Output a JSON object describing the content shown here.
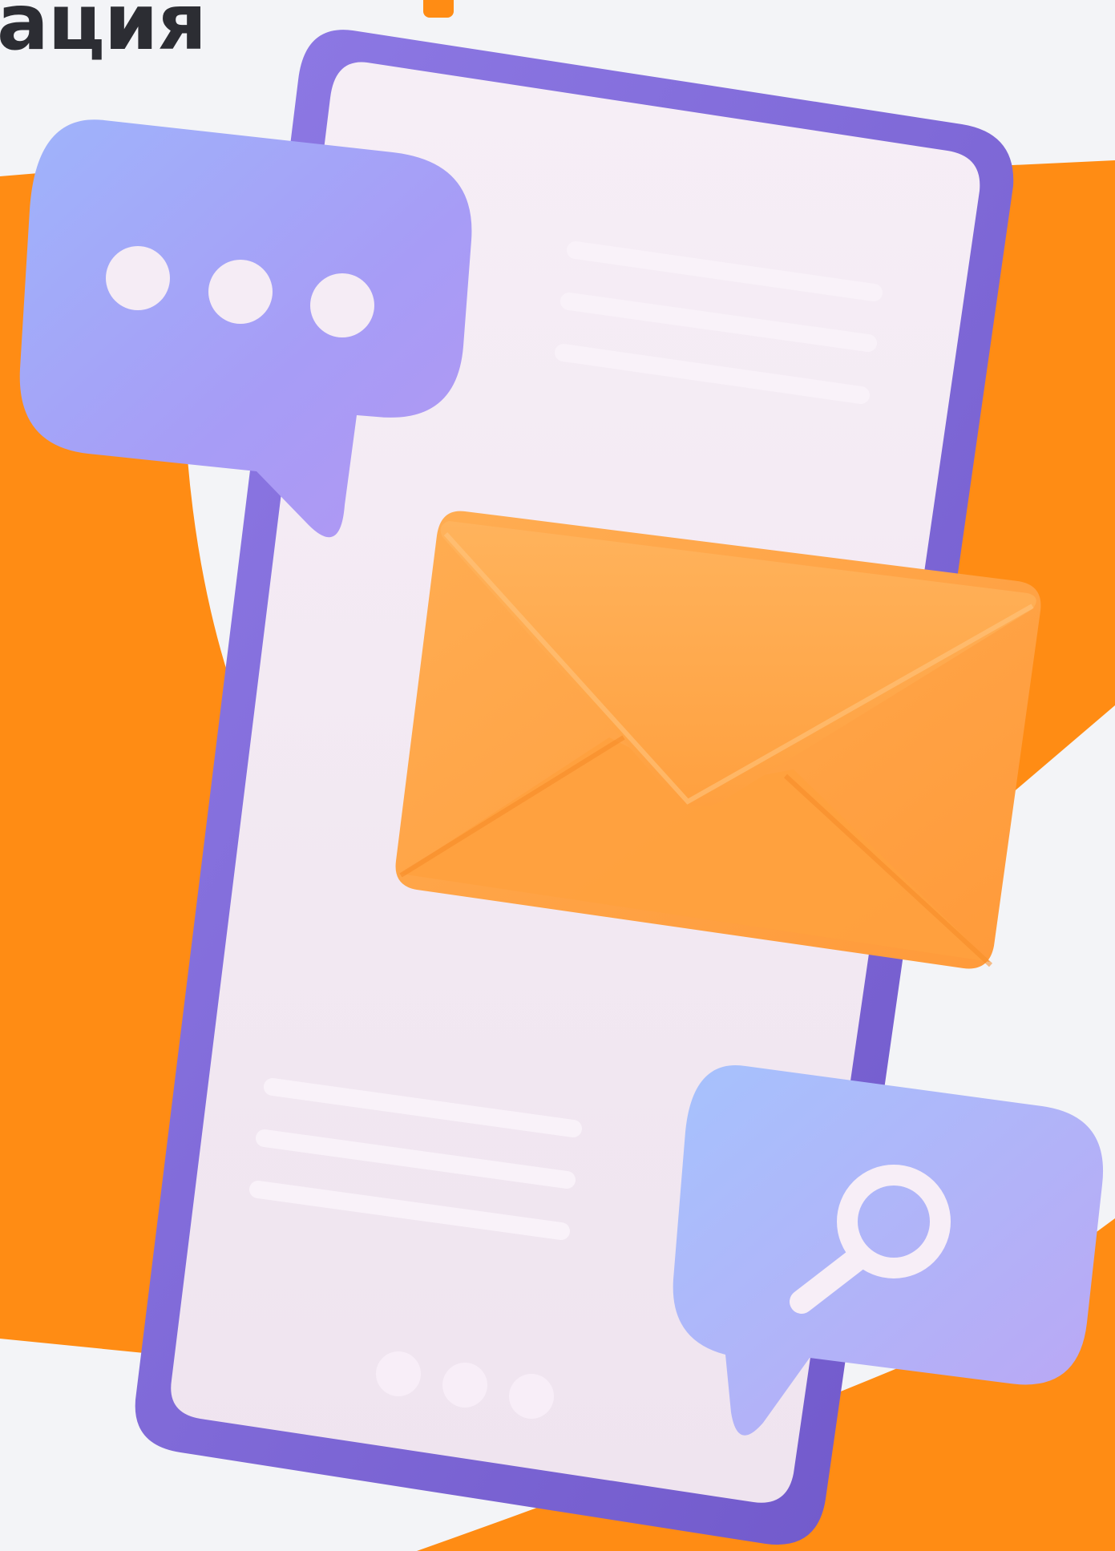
{
  "heading": {
    "text": "ация"
  },
  "colors": {
    "background": "#f3f4f7",
    "accent_orange": "#ff8c14",
    "phone_frame": "#8a72dc",
    "phone_screen": "#f1e8f1",
    "bubble_blue": "#a7b5fb",
    "envelope": "#ffa645",
    "heading_text": "#2c2d33"
  },
  "illustration": {
    "chat_bubble_icon": "ellipsis-icon",
    "search_bubble_icon": "search-icon",
    "envelope_icon": "envelope-icon",
    "phone_icon": "smartphone-icon"
  }
}
